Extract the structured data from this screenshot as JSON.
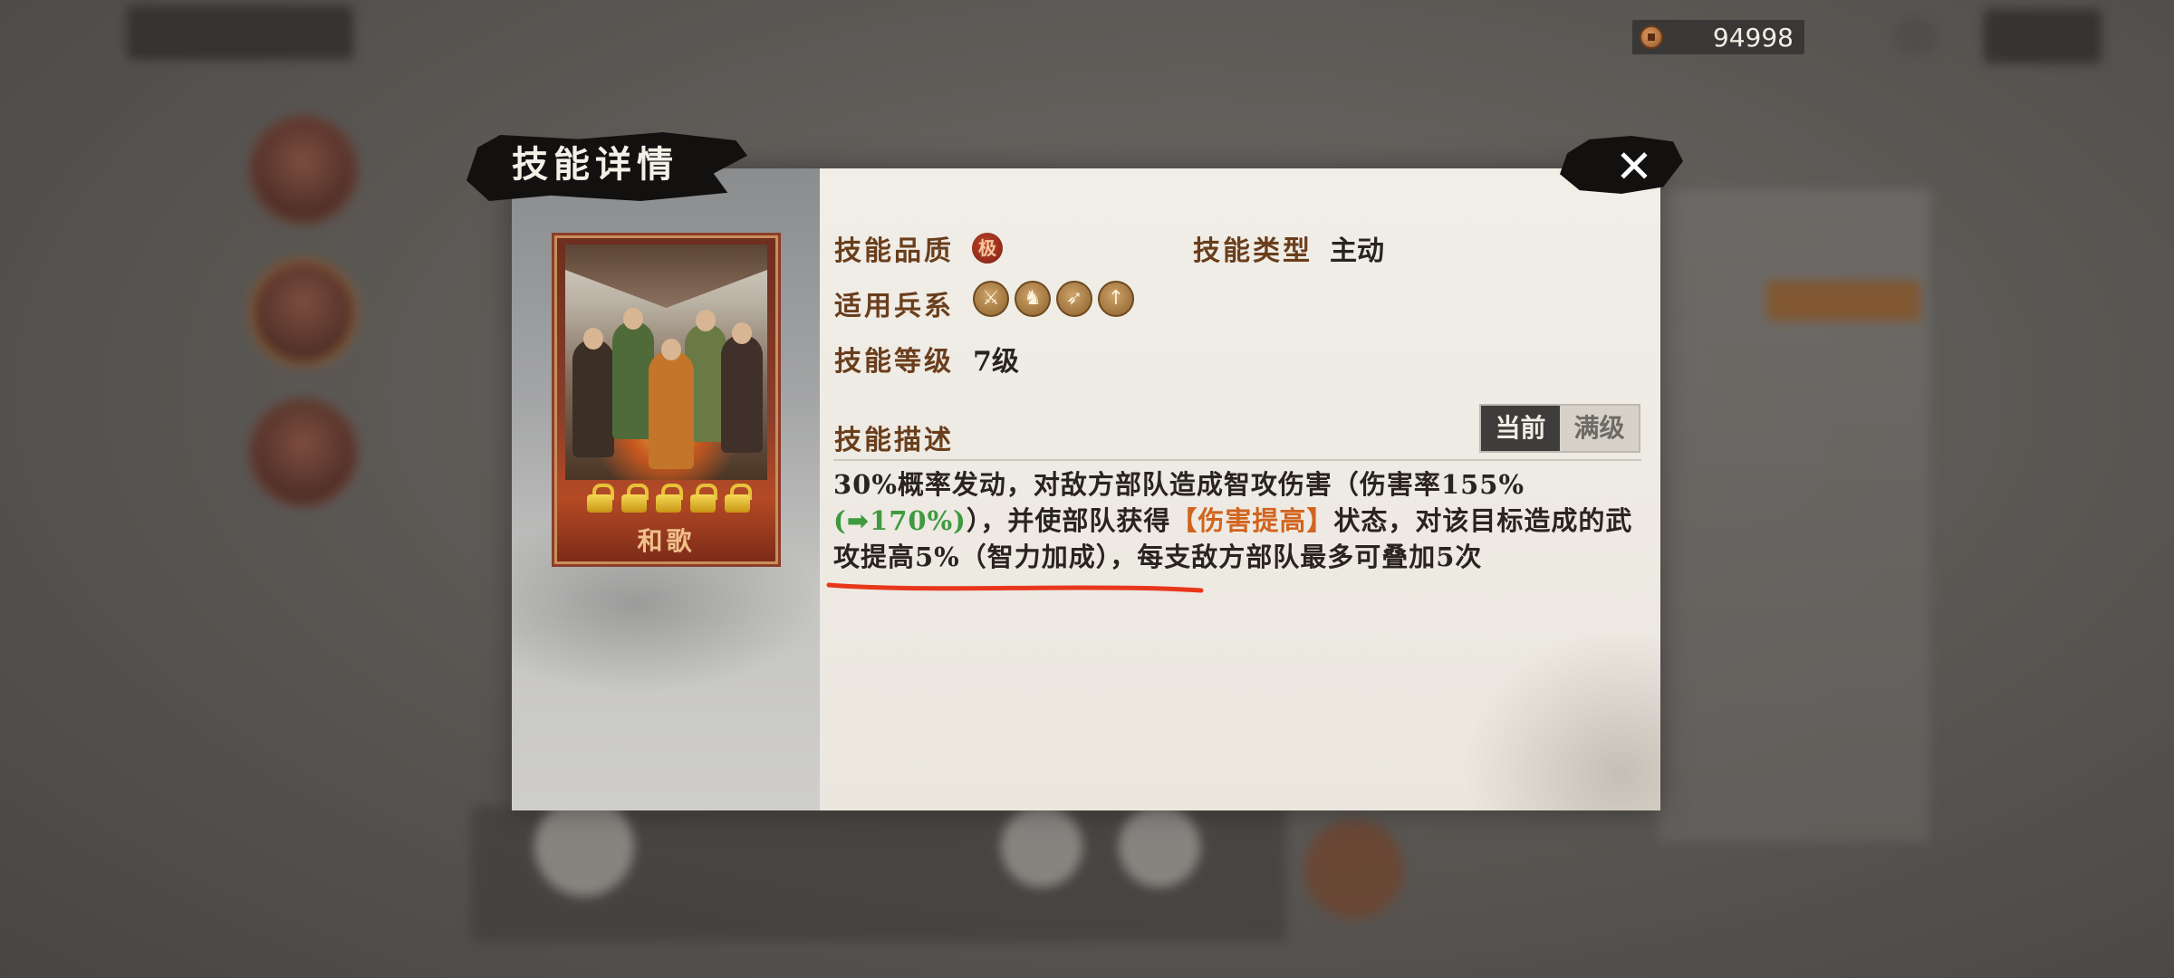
{
  "hud": {
    "coins": "94998"
  },
  "dialog": {
    "title": "技能详情",
    "card": {
      "name": "和歌",
      "stars": 5
    },
    "rows": {
      "quality_label": "技能品质",
      "quality_badge": "极",
      "type_label": "技能类型",
      "type_value": "主动",
      "troops_label": "适用兵系",
      "troops": [
        "sword-icon",
        "horse-icon",
        "bow-icon",
        "spear-icon"
      ],
      "level_label": "技能等级",
      "level_value": "7级",
      "desc_label": "技能描述"
    },
    "tabs": {
      "current": "当前",
      "max": "满级"
    },
    "description": {
      "part1": "30%概率发动，对敌方部队造成智攻伤害（伤害率155%",
      "upgrade_open": "(",
      "upgrade_arrow": "➡",
      "upgrade_value": "170%)",
      "part2": "），并使部队获得",
      "status": "【伤害提高】",
      "part3": "状态，对该目标造成的武攻提高5%（智力加成），每支敌方部队最多可叠加5次"
    },
    "colors": {
      "label": "#6a3e1c",
      "green": "#3f9a3f",
      "orange": "#d1641f",
      "underline": "#e8371a"
    }
  }
}
